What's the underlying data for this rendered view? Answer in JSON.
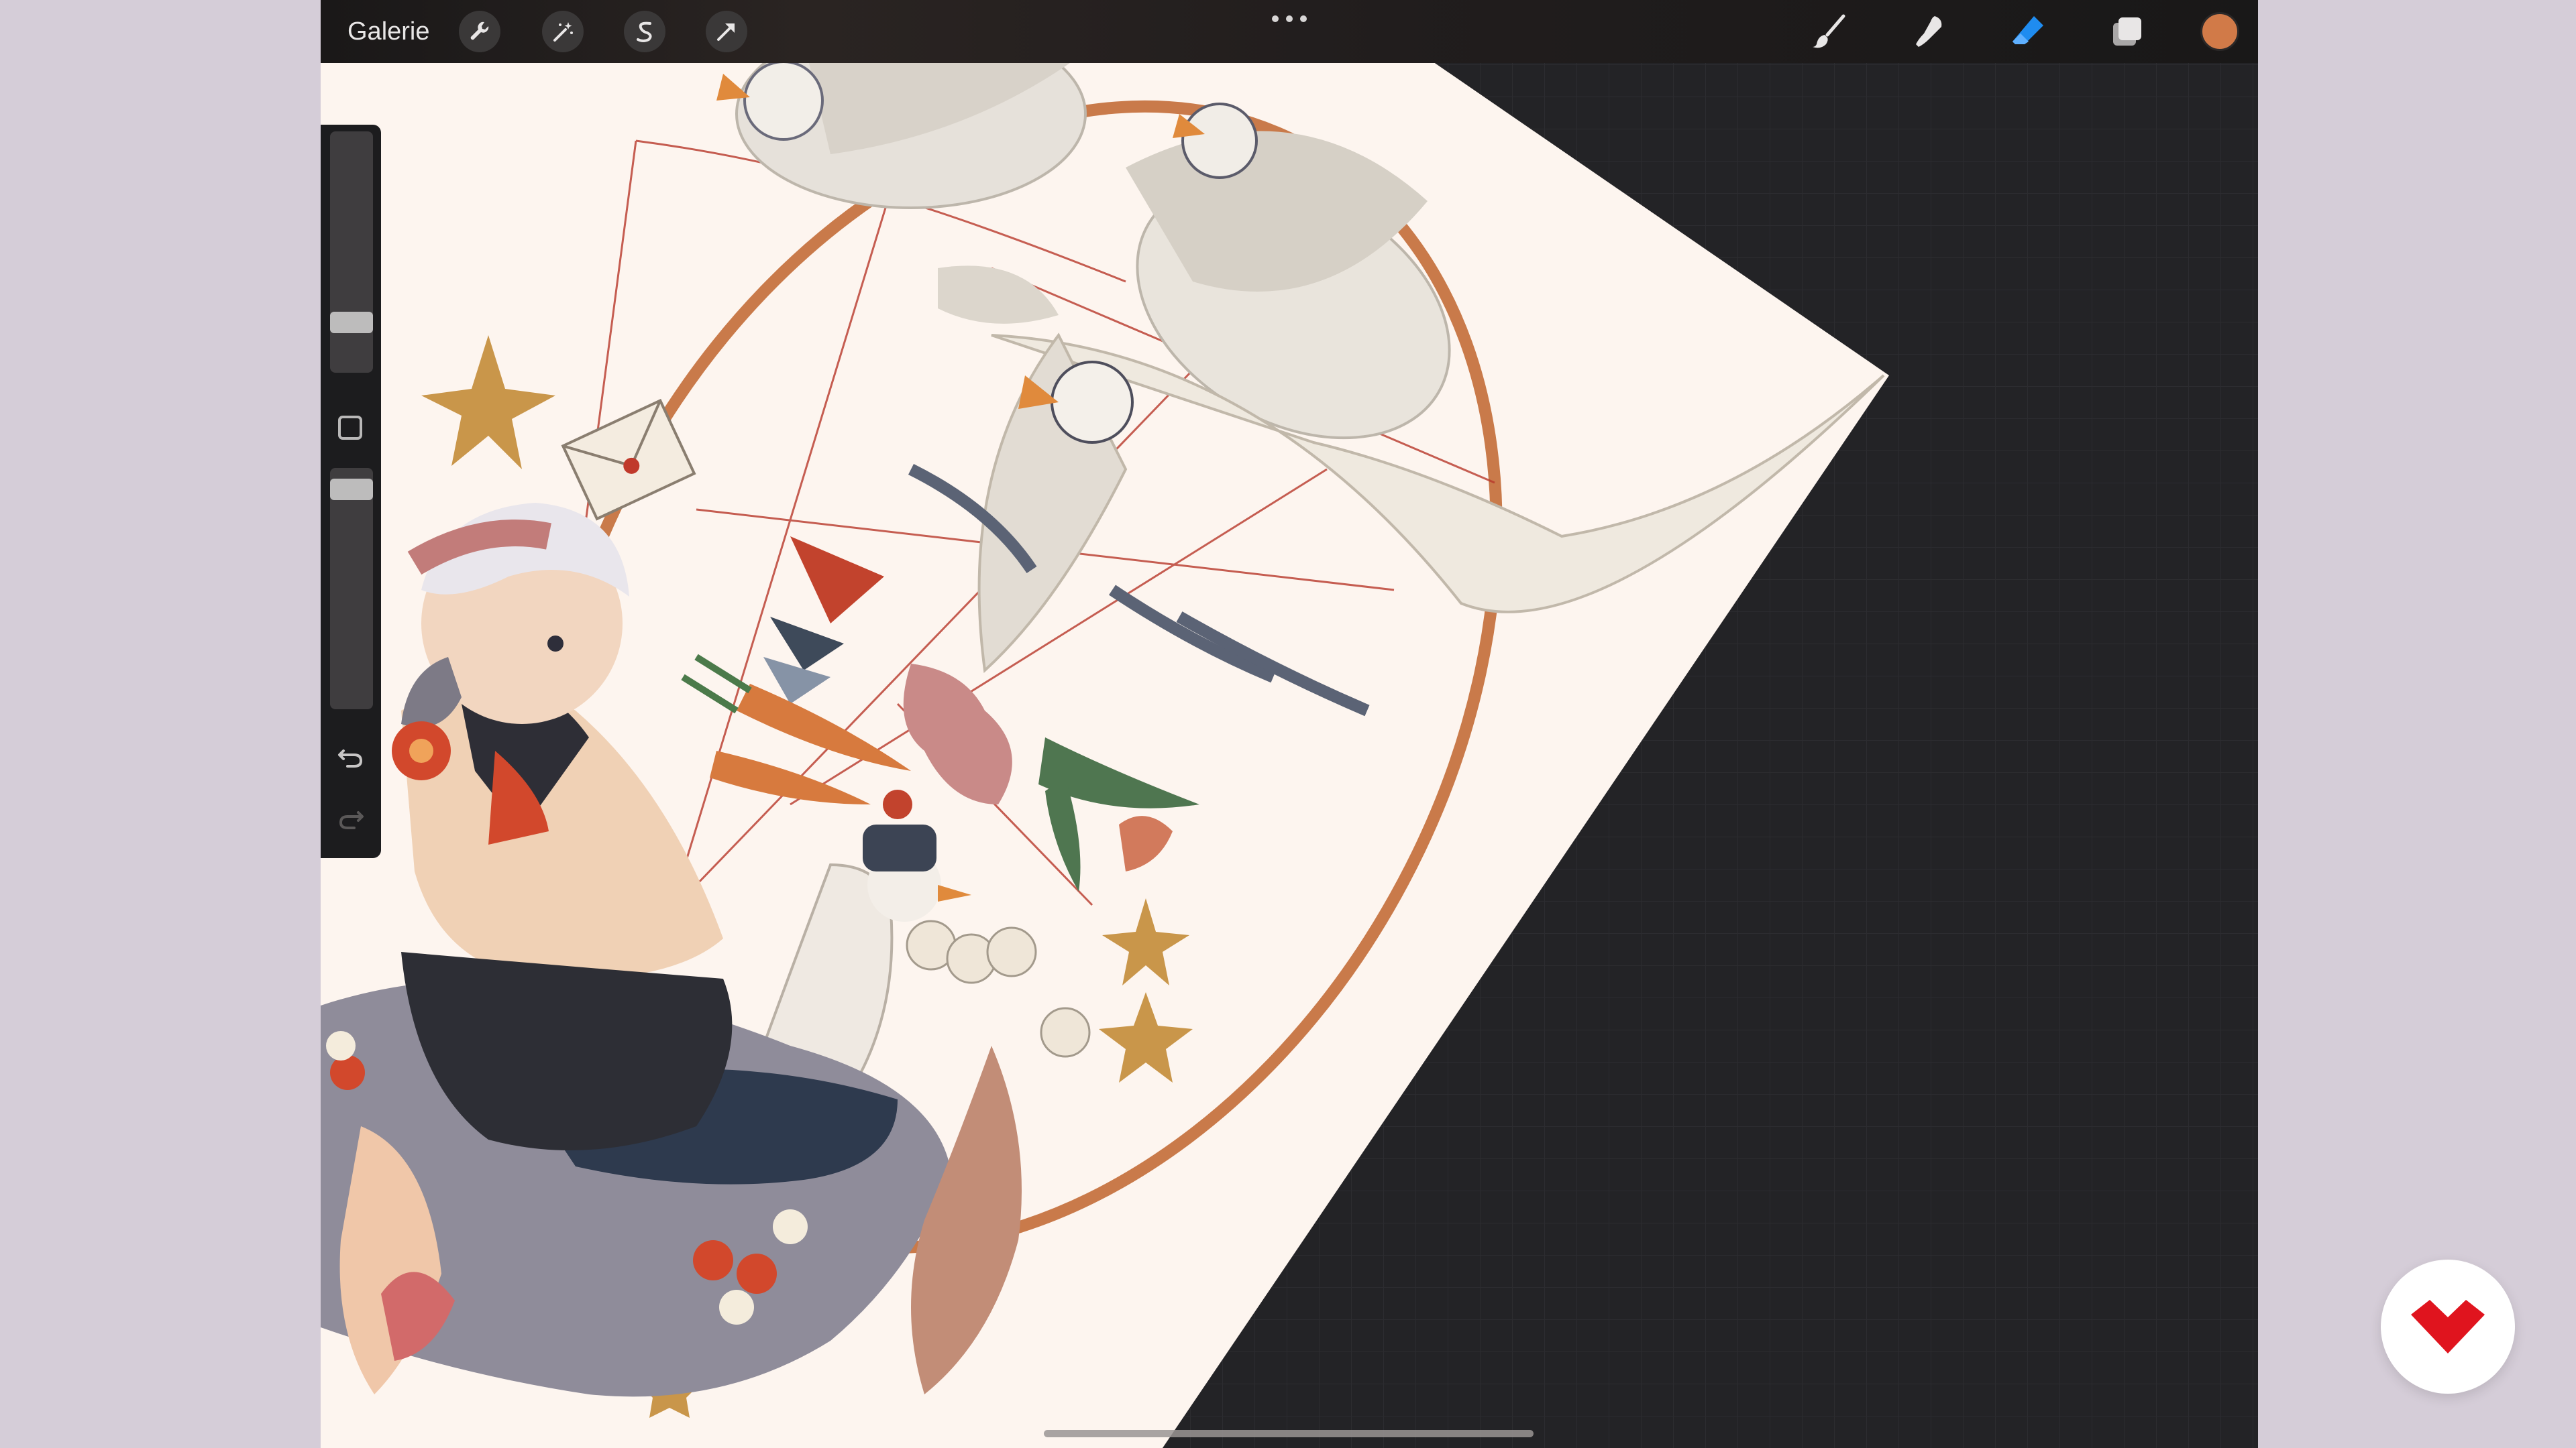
{
  "toolbar": {
    "gallery_label": "Galerie",
    "left_tools": [
      "wrench-icon",
      "magic-wand-icon",
      "selection-s-icon",
      "transform-arrow-icon"
    ],
    "right_tools": [
      "brush-icon",
      "smudge-icon",
      "eraser-icon",
      "layers-icon"
    ],
    "active_tool": "eraser",
    "active_tool_color": "#1f8cf0",
    "current_color": "#d17a48"
  },
  "sidebar": {
    "brush_size_level": 0.18,
    "opacity_level": 0.95,
    "icons": [
      "modify-square-icon",
      "undo-icon",
      "redo-icon"
    ]
  },
  "artwork": {
    "paper_color": "#fdf5ef",
    "workspace_color": "#232326"
  },
  "brand": {
    "logo_color": "#e0141e"
  }
}
